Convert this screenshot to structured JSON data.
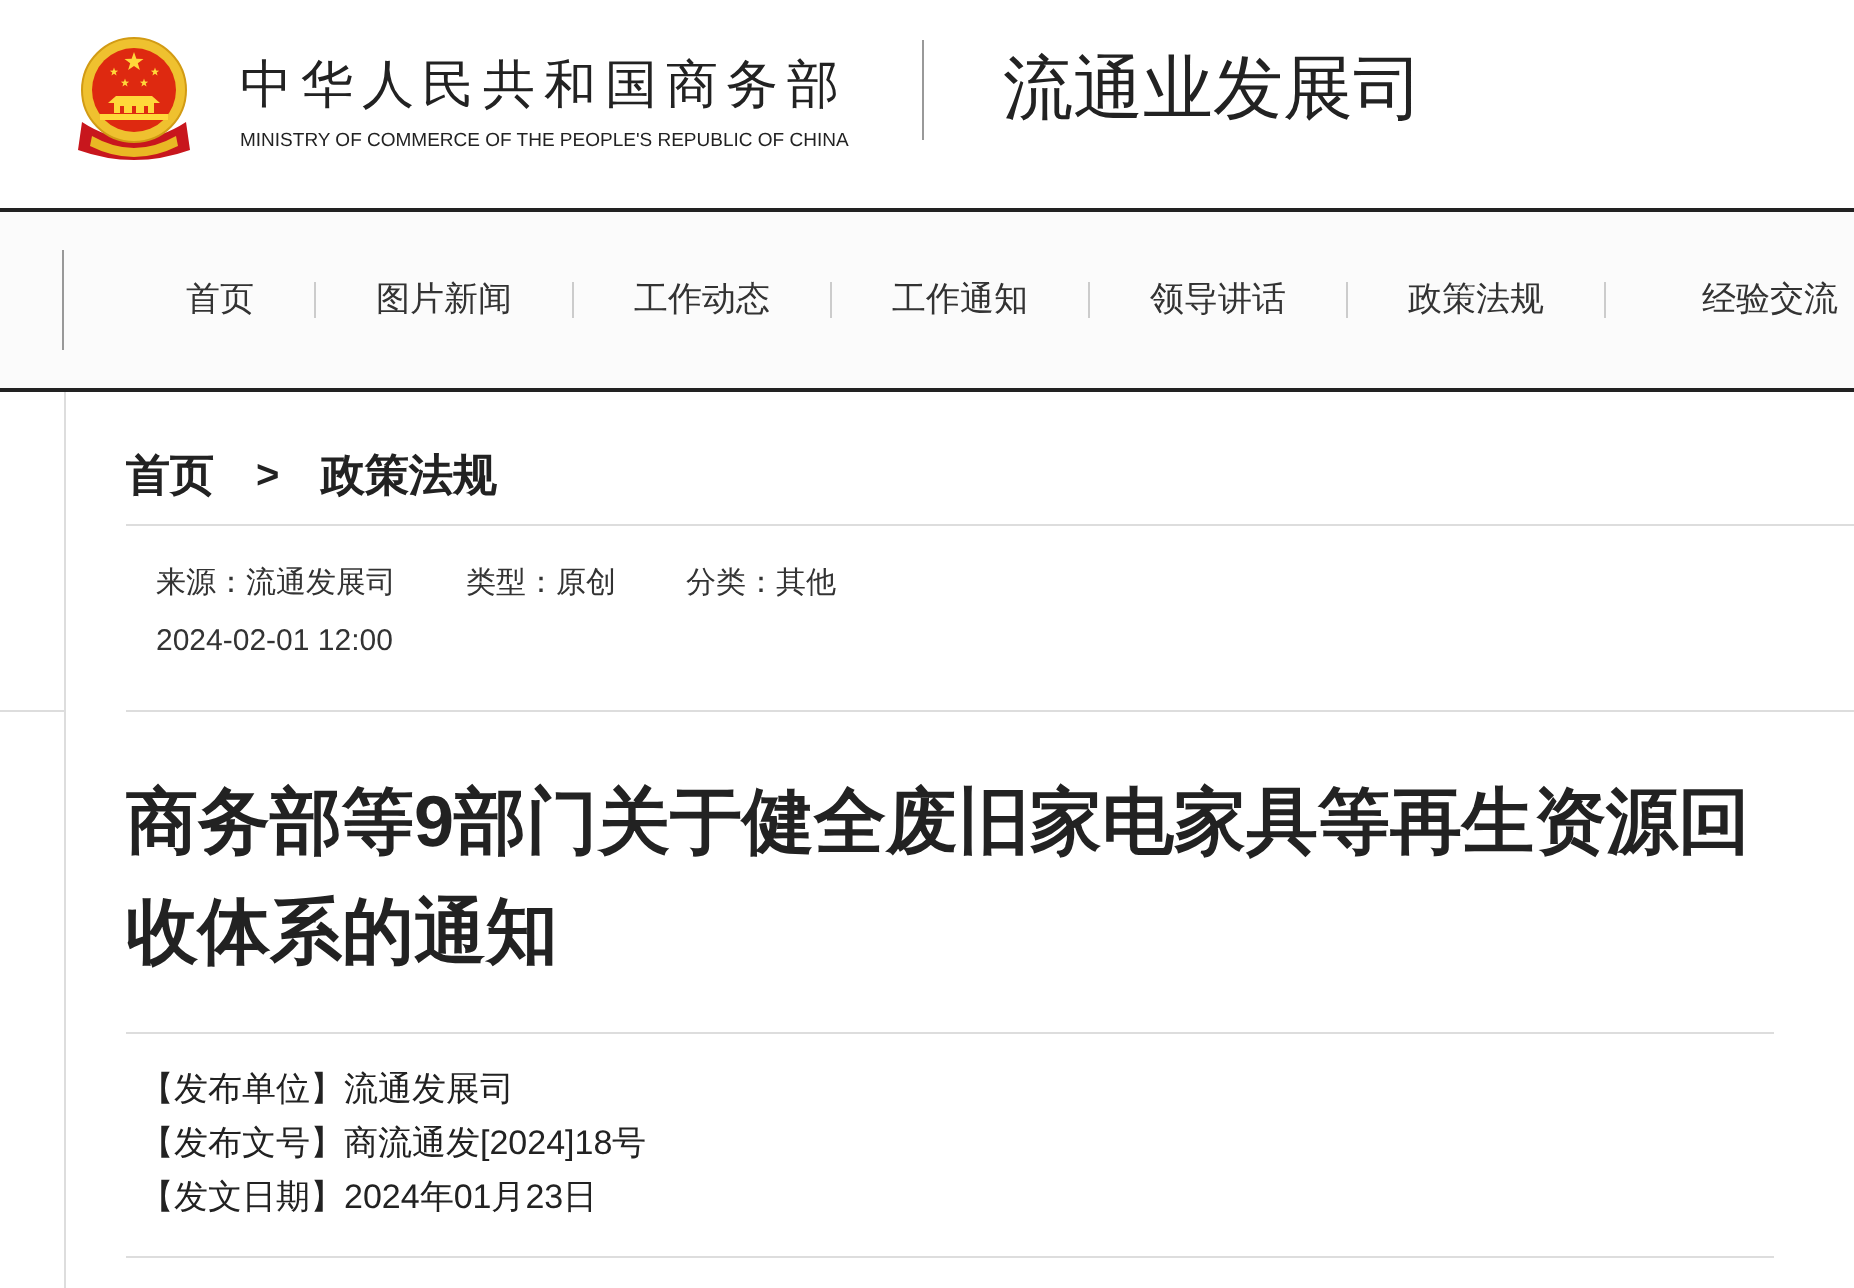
{
  "header": {
    "org_name": "中华人民共和国商务部",
    "org_name_en": "MINISTRY OF COMMERCE OF THE PEOPLE'S REPUBLIC OF CHINA",
    "department": "流通业发展司"
  },
  "nav": [
    "首页",
    "图片新闻",
    "工作动态",
    "工作通知",
    "领导讲话",
    "政策法规",
    "经验交流"
  ],
  "breadcrumb": {
    "items": [
      "首页",
      "政策法规"
    ],
    "separator": ">"
  },
  "article_meta": {
    "fields": [
      "来源：流通发展司",
      "类型：原创",
      "分类：其他"
    ],
    "date": "2024-02-01 12:00"
  },
  "article": {
    "title": "商务部等9部门关于健全废旧家电家具等再生资源回收体系的通知",
    "info": [
      "【发布单位】流通发展司",
      "【发布文号】商流通发[2024]18号",
      "【发文日期】2024年01月23日"
    ]
  }
}
